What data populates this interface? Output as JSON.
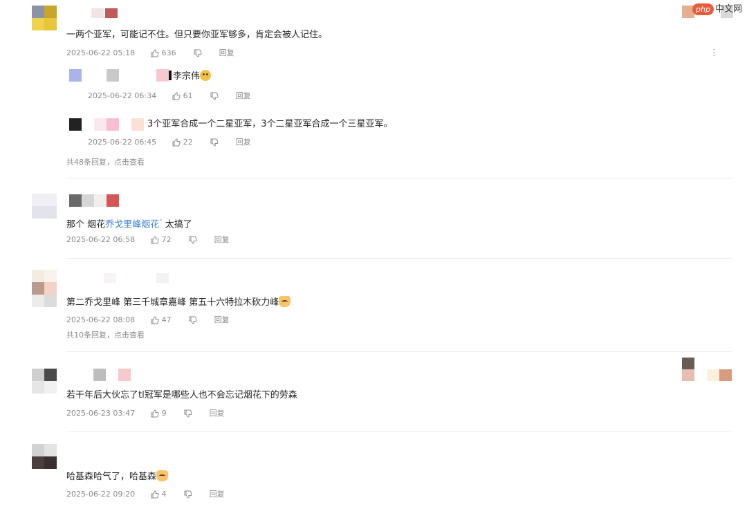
{
  "watermark": {
    "php": "php",
    "text": "中文网"
  },
  "comments": [
    {
      "text": "一两个亚军，可能记不住。但只要你亚军够多，肯定会被人记住。",
      "time": "2025-06-22 05:18",
      "likes": "636",
      "reply": "回复",
      "more_menu": "⋮",
      "replies": [
        {
          "text": "李宗伟",
          "time": "2025-06-22 06:34",
          "likes": "61",
          "reply": "回复"
        },
        {
          "text": "3个亚军合成一个二星亚军，3个二星亚军合成一个三星亚军。",
          "time": "2025-06-22 06:45",
          "likes": "22",
          "reply": "回复"
        }
      ],
      "view_more": "共48条回复，点击查看"
    },
    {
      "text_before": "那个 烟花",
      "link_text": "乔戈里峰烟花",
      "link_mark": "°",
      "text_after": " 太搞了",
      "time": "2025-06-22 06:58",
      "likes": "72",
      "reply": "回复"
    },
    {
      "text": "第二乔戈里峰 第三千城章嘉峰 第五十六特拉木砍力峰",
      "time": "2025-06-22 08:08",
      "likes": "47",
      "reply": "回复",
      "view_more": "共10条回复，点击查看"
    },
    {
      "text": "若干年后大伙忘了tl冠军是哪些人也不会忘记烟花下的劳森",
      "time": "2025-06-23 03:47",
      "likes": "9",
      "reply": "回复"
    },
    {
      "text": "哈基森哈气了，哈基森",
      "time": "2025-06-22 09:20",
      "likes": "4",
      "reply": "回复"
    }
  ],
  "icons": {
    "like": "thumbs-up-icon",
    "dislike": "thumbs-down-icon",
    "more": "more-vertical-icon"
  },
  "colors": {
    "link": "#3d7fd6",
    "meta": "#8a8a8a",
    "divider": "#ececec"
  }
}
